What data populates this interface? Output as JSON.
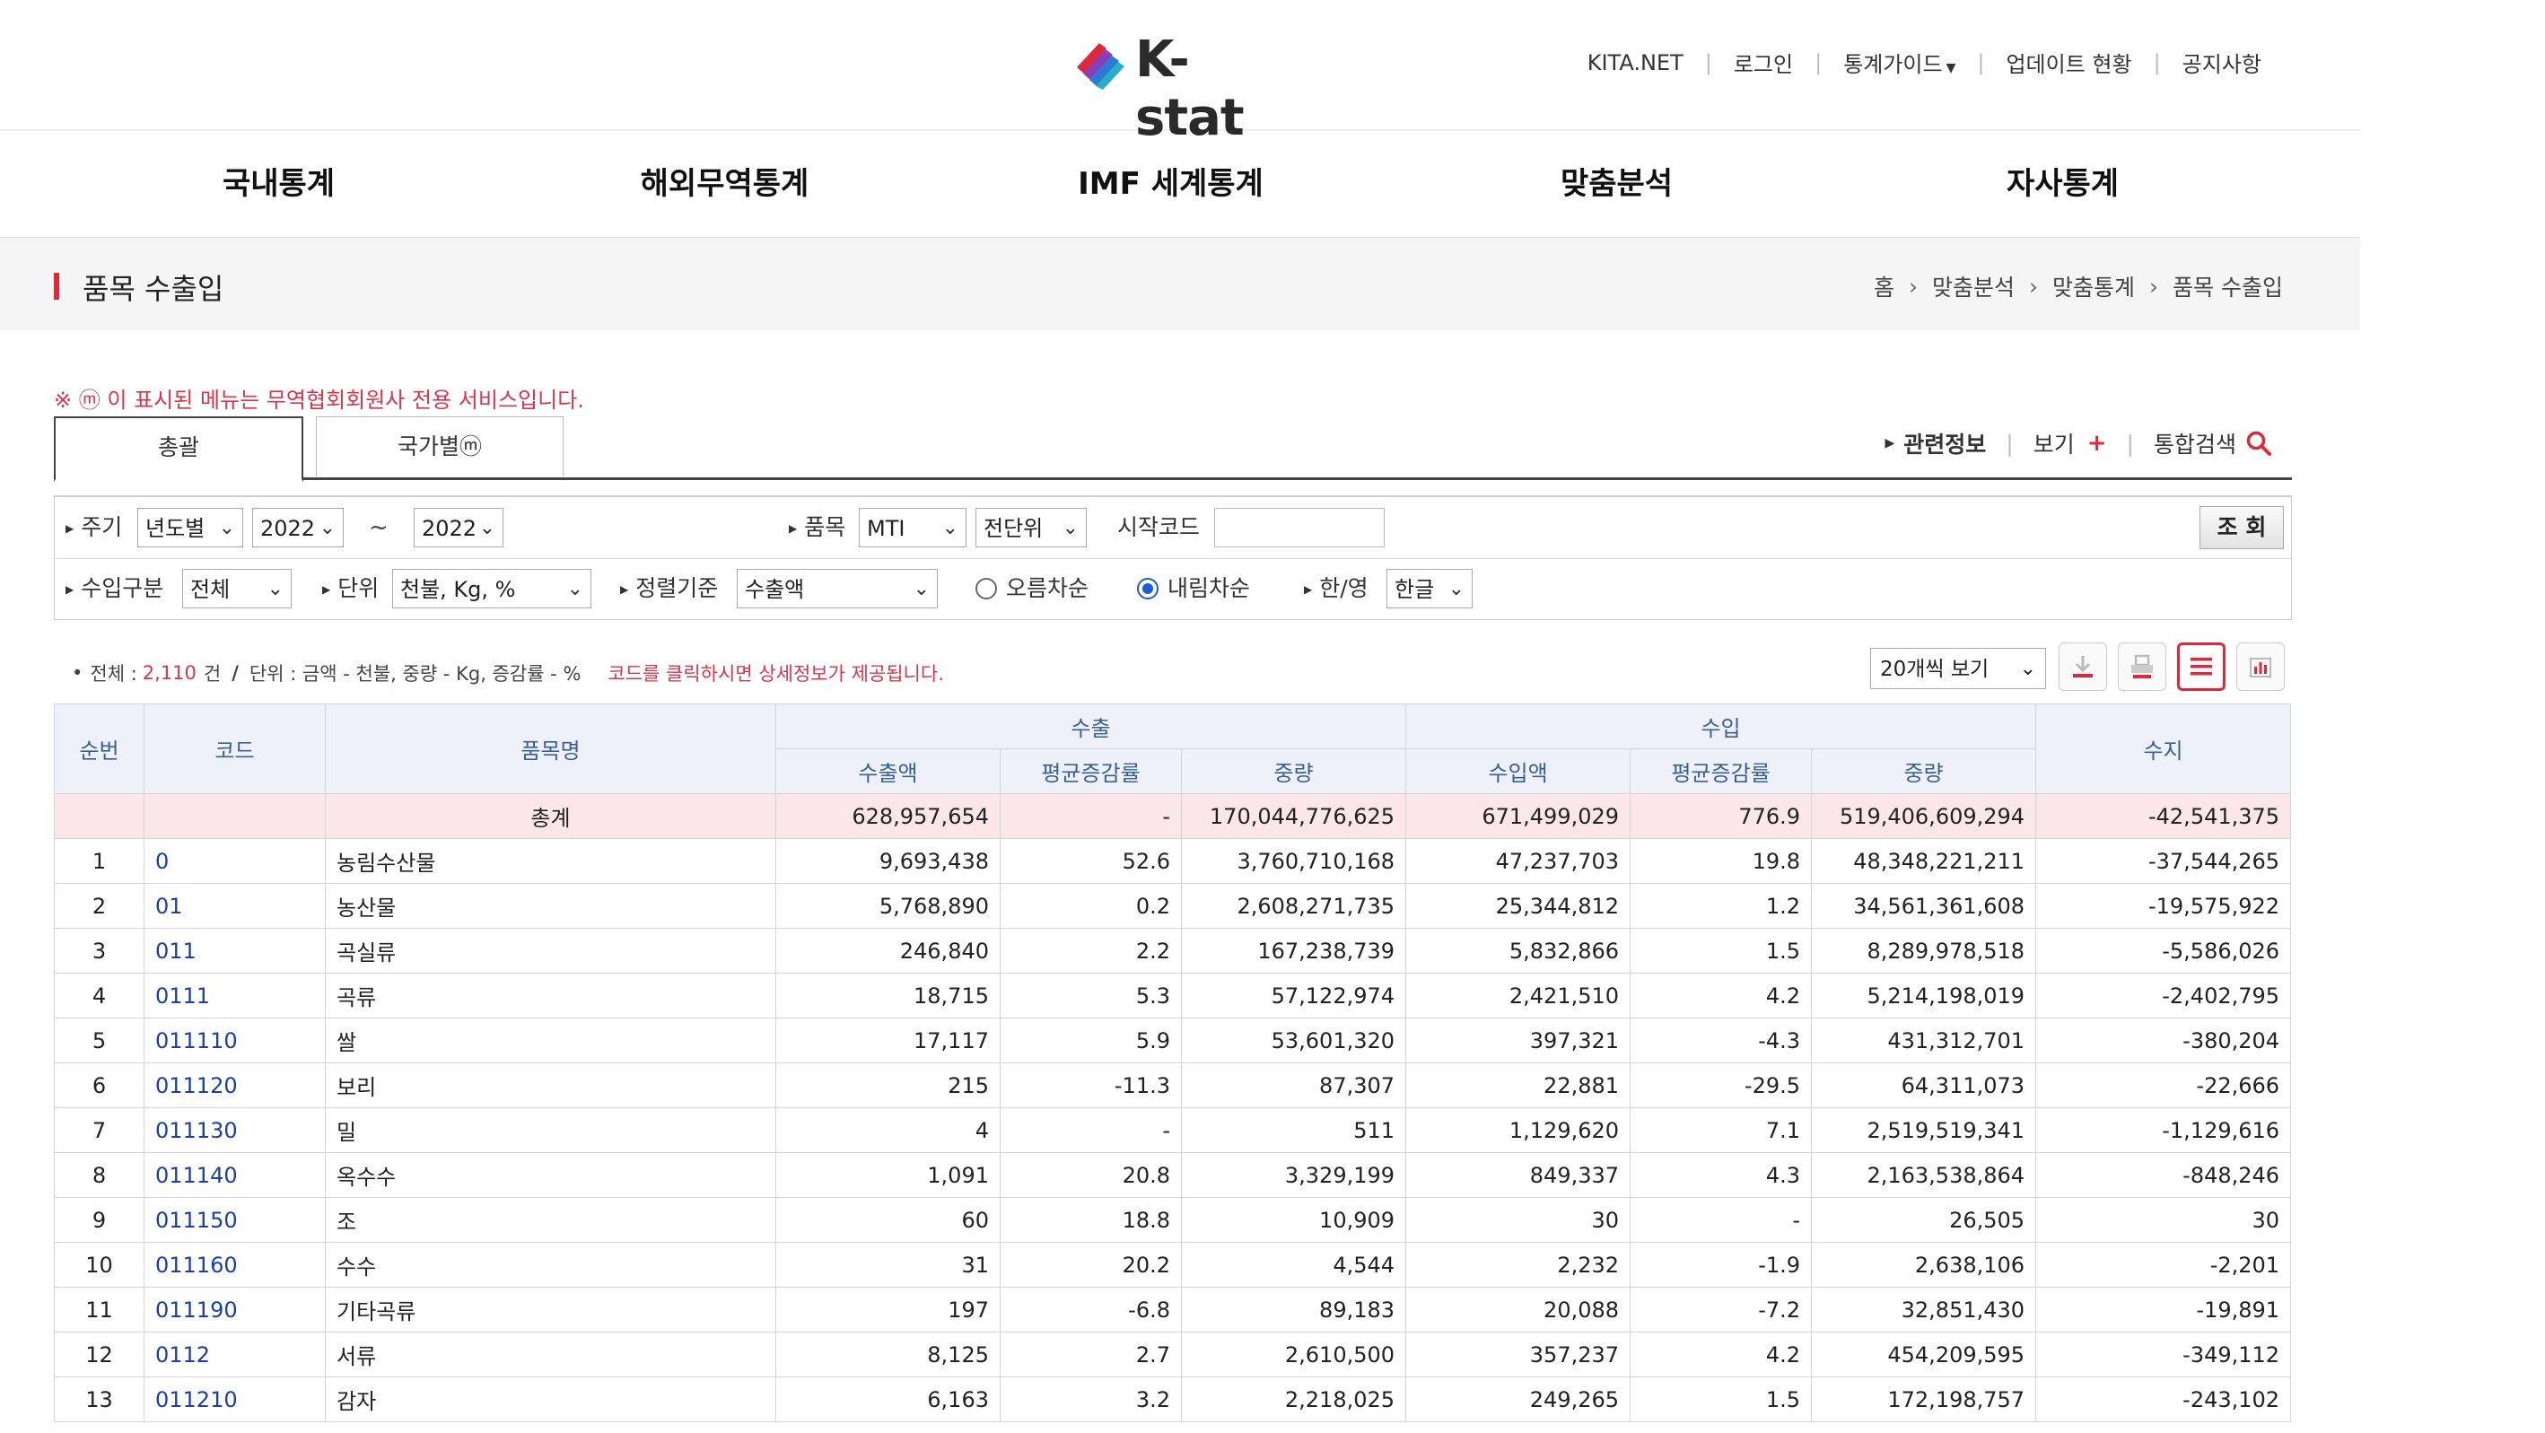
{
  "header": {
    "logo_text": "K-stat",
    "util_nav": [
      "KITA.NET",
      "로그인",
      "통계가이드",
      "업데이트 현황",
      "공지사항"
    ]
  },
  "mainnav": [
    "국내통계",
    "해외무역통계",
    "IMF 세계통계",
    "맞춤분석",
    "자사통계"
  ],
  "titlebar": {
    "title": "품목 수출입",
    "breadcrumb": [
      "홈",
      "맞춤분석",
      "맞춤통계",
      "품목 수출입"
    ]
  },
  "notice": "※ ⓜ 이 표시된 메뉴는 무역협회회원사 전용 서비스입니다.",
  "tabs": [
    "총괄",
    "국가별ⓜ"
  ],
  "related": {
    "info": "관련정보",
    "view": "보기",
    "search": "통합검색"
  },
  "filters": {
    "period_label": "주기",
    "period_value": "년도별",
    "year_from": "2022",
    "tilde": "~",
    "year_to": "2022",
    "item_label": "품목",
    "item_value": "MTI",
    "unit_level": "전단위",
    "start_code_label": "시작코드",
    "start_code_value": "",
    "search_button": "조 회",
    "trade_type_label": "수입구분",
    "trade_type_value": "전체",
    "unit_label": "단위",
    "unit_value": "천불, Kg, %",
    "sort_label": "정렬기준",
    "sort_value": "수출액",
    "asc_label": "오름차순",
    "desc_label": "내림차순",
    "sort_order": "desc",
    "lang_label": "한/영",
    "lang_value": "한글"
  },
  "summary": {
    "total_prefix": "전체 :",
    "total_count": "2,110",
    "total_suffix": "건",
    "unit_text": "단위 : 금액 - 천불, 중량 - Kg, 증감률 - %",
    "note": "코드를 클릭하시면 상세정보가 제공됩니다.",
    "per_page": "20개씩 보기"
  },
  "table": {
    "headers": {
      "seq": "순번",
      "code": "코드",
      "name": "품목명",
      "export": "수출",
      "import": "수입",
      "balance": "수지",
      "export_cols": [
        "수출액",
        "평균증감률",
        "중량"
      ],
      "import_cols": [
        "수입액",
        "평균증감률",
        "중량"
      ]
    },
    "total": {
      "label": "총계",
      "values": [
        "628,957,654",
        "-",
        "170,044,776,625",
        "671,499,029",
        "776.9",
        "519,406,609,294",
        "-42,541,375"
      ]
    },
    "rows": [
      [
        "1",
        "0",
        "농림수산물",
        "9,693,438",
        "52.6",
        "3,760,710,168",
        "47,237,703",
        "19.8",
        "48,348,221,211",
        "-37,544,265"
      ],
      [
        "2",
        "01",
        "농산물",
        "5,768,890",
        "0.2",
        "2,608,271,735",
        "25,344,812",
        "1.2",
        "34,561,361,608",
        "-19,575,922"
      ],
      [
        "3",
        "011",
        "곡실류",
        "246,840",
        "2.2",
        "167,238,739",
        "5,832,866",
        "1.5",
        "8,289,978,518",
        "-5,586,026"
      ],
      [
        "4",
        "0111",
        "곡류",
        "18,715",
        "5.3",
        "57,122,974",
        "2,421,510",
        "4.2",
        "5,214,198,019",
        "-2,402,795"
      ],
      [
        "5",
        "011110",
        "쌀",
        "17,117",
        "5.9",
        "53,601,320",
        "397,321",
        "-4.3",
        "431,312,701",
        "-380,204"
      ],
      [
        "6",
        "011120",
        "보리",
        "215",
        "-11.3",
        "87,307",
        "22,881",
        "-29.5",
        "64,311,073",
        "-22,666"
      ],
      [
        "7",
        "011130",
        "밀",
        "4",
        "-",
        "511",
        "1,129,620",
        "7.1",
        "2,519,519,341",
        "-1,129,616"
      ],
      [
        "8",
        "011140",
        "옥수수",
        "1,091",
        "20.8",
        "3,329,199",
        "849,337",
        "4.3",
        "2,163,538,864",
        "-848,246"
      ],
      [
        "9",
        "011150",
        "조",
        "60",
        "18.8",
        "10,909",
        "30",
        "-",
        "26,505",
        "30"
      ],
      [
        "10",
        "011160",
        "수수",
        "31",
        "20.2",
        "4,544",
        "2,232",
        "-1.9",
        "2,638,106",
        "-2,201"
      ],
      [
        "11",
        "011190",
        "기타곡류",
        "197",
        "-6.8",
        "89,183",
        "20,088",
        "-7.2",
        "32,851,430",
        "-19,891"
      ],
      [
        "12",
        "0112",
        "서류",
        "8,125",
        "2.7",
        "2,610,500",
        "357,237",
        "4.2",
        "454,209,595",
        "-349,112"
      ],
      [
        "13",
        "011210",
        "감자",
        "6,163",
        "3.2",
        "2,218,025",
        "249,265",
        "1.5",
        "172,198,757",
        "-243,102"
      ]
    ]
  },
  "colors": {
    "accent": "#e0283c",
    "header_text": "#3a5f96",
    "header_bg": "#eef2f8",
    "total_bg": "#fbe7ea",
    "code_link": "#1b3fa8"
  }
}
